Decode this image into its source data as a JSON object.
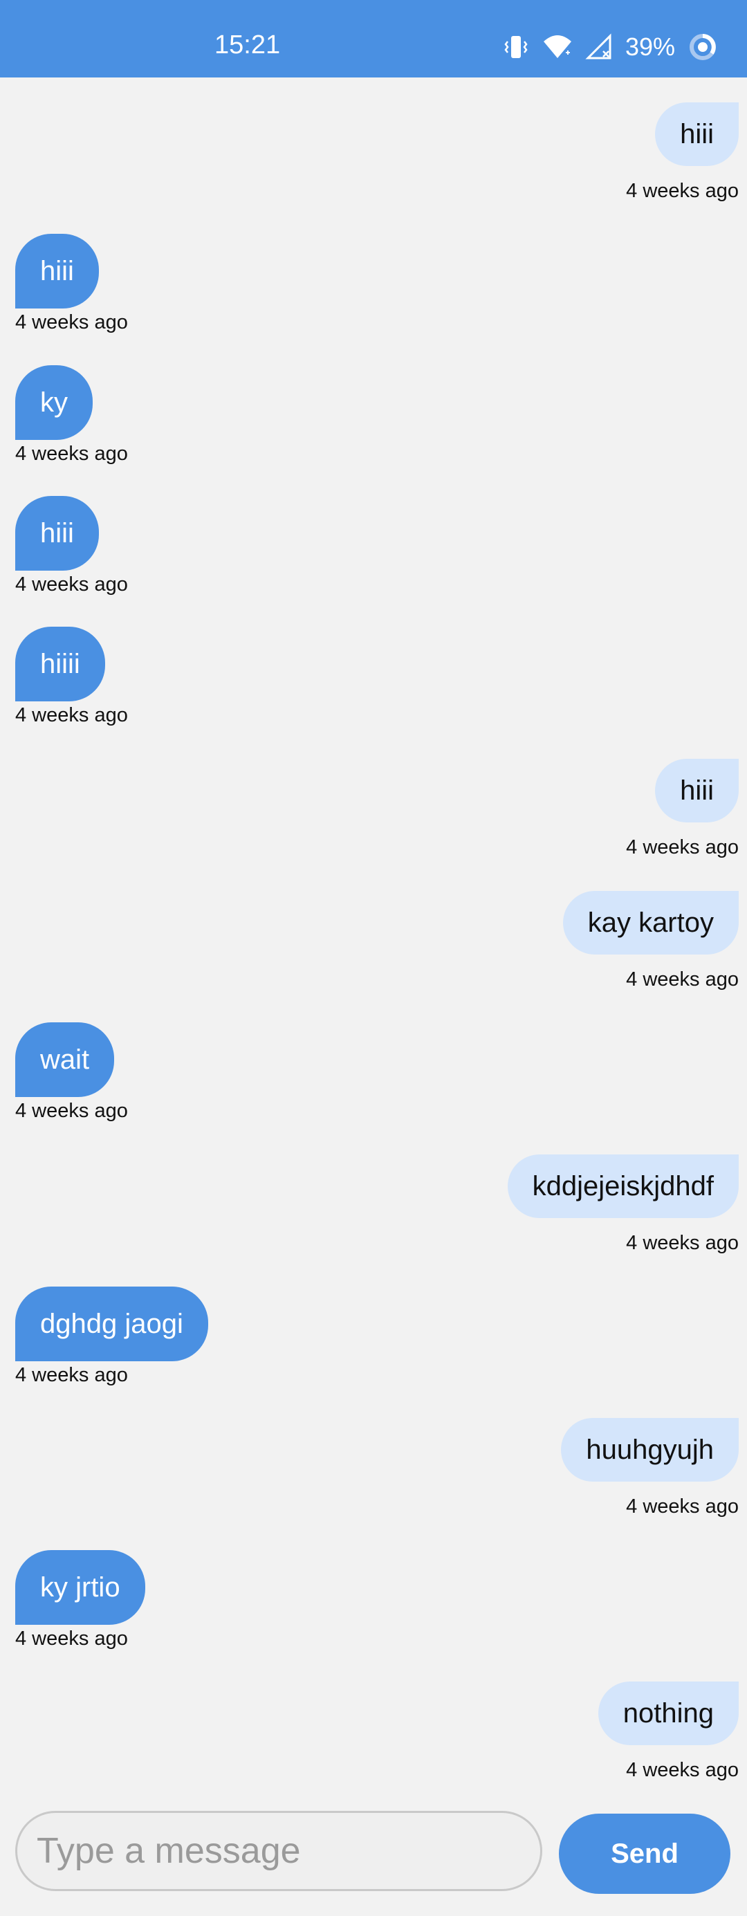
{
  "status_bar": {
    "time": "15:21",
    "battery_percent": "39%",
    "icons": [
      "vibrate-icon",
      "wifi-icon",
      "no-signal-icon",
      "battery-ring-icon"
    ],
    "color": "#4a90e2"
  },
  "messages": [
    {
      "direction": "out",
      "text": "hiii",
      "time": "4 weeks ago"
    },
    {
      "direction": "in",
      "text": "hiii",
      "time": "4 weeks ago"
    },
    {
      "direction": "in",
      "text": "ky",
      "time": "4 weeks ago"
    },
    {
      "direction": "in",
      "text": "hiii",
      "time": "4 weeks ago"
    },
    {
      "direction": "in",
      "text": "hiiii",
      "time": "4 weeks ago"
    },
    {
      "direction": "out",
      "text": "hiii",
      "time": "4 weeks ago"
    },
    {
      "direction": "out",
      "text": "kay kartoy",
      "time": "4 weeks ago"
    },
    {
      "direction": "in",
      "text": "wait",
      "time": "4 weeks ago"
    },
    {
      "direction": "out",
      "text": "kddjejeiskjdhdf",
      "time": "4 weeks ago"
    },
    {
      "direction": "in",
      "text": "dghdg jaogi",
      "time": "4 weeks ago"
    },
    {
      "direction": "out",
      "text": "huuhgyujh",
      "time": "4 weeks ago"
    },
    {
      "direction": "in",
      "text": "ky jrtio",
      "time": "4 weeks ago"
    },
    {
      "direction": "out",
      "text": "nothing",
      "time": "4 weeks ago"
    }
  ],
  "composer": {
    "placeholder": "Type a message",
    "value": "",
    "send_label": "Send"
  },
  "colors": {
    "incoming_bubble": "#4a90e2",
    "outgoing_bubble": "#d4e5fb",
    "background": "#f2f2f2"
  }
}
